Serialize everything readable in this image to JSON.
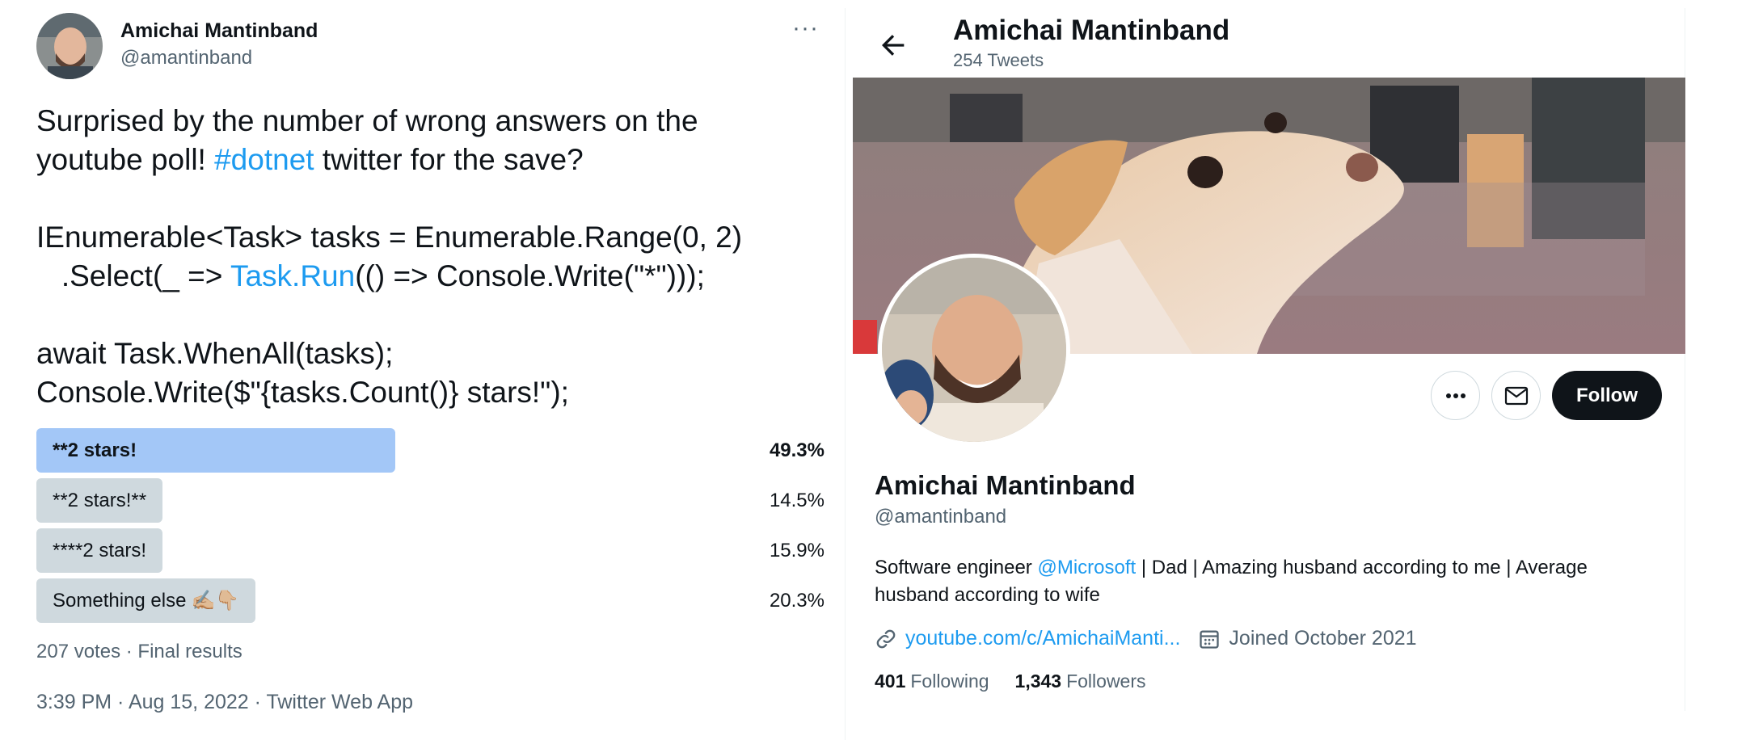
{
  "tweet": {
    "author_name": "Amichai Mantinband",
    "author_handle": "@amantinband",
    "more_icon": "···",
    "text": {
      "line1": "Surprised by the number of wrong answers on the",
      "line2_a": "youtube poll! ",
      "line2_hashtag": "#dotnet",
      "line2_b": " twitter for the save?",
      "line3": "IEnumerable<Task> tasks = Enumerable.Range(0, 2)",
      "line4_a": "   .Select(_ => ",
      "line4_link": "Task.Run",
      "line4_b": "(() => Console.Write(\"*\")));",
      "line5": "await Task.WhenAll(tasks);",
      "line6": "Console.Write($\"{tasks.Count()} stars!\");"
    },
    "poll": {
      "options": [
        {
          "label": "**2 stars!",
          "percent": "49.3%",
          "share": 0.493,
          "winner": true
        },
        {
          "label": "**2 stars!**",
          "percent": "14.5%",
          "share": 0.145,
          "winner": false
        },
        {
          "label": "****2 stars!",
          "percent": "15.9%",
          "share": 0.159,
          "winner": false
        },
        {
          "label": "Something else",
          "emoji": "✍🏼👇🏼",
          "percent": "20.3%",
          "share": 0.203,
          "winner": false
        }
      ],
      "summary": "207 votes · Final results"
    },
    "timestamp": "3:39 PM · Aug 15, 2022 · Twitter Web App"
  },
  "profile": {
    "header_name": "Amichai Mantinband",
    "tweet_count": "254 Tweets",
    "follow_label": "Follow",
    "name": "Amichai Mantinband",
    "handle": "@amantinband",
    "bio_a": "Software engineer ",
    "bio_mention": "@Microsoft",
    "bio_b": " | Dad | Amazing husband according to me | Average husband according to wife",
    "url": "youtube.com/c/AmichaiManti...",
    "joined": "Joined October 2021",
    "following_count": "401",
    "following_label": "Following",
    "followers_count": "1,343",
    "followers_label": "Followers"
  },
  "colors": {
    "accent": "#1d9bf0",
    "poll_winner": "#a3c7f7",
    "poll_other": "#cfd9de",
    "secondary_text": "#536471"
  },
  "icons": [
    "more-icon",
    "back-arrow-icon",
    "more-horizontal-icon",
    "mail-icon",
    "link-icon",
    "calendar-icon"
  ]
}
